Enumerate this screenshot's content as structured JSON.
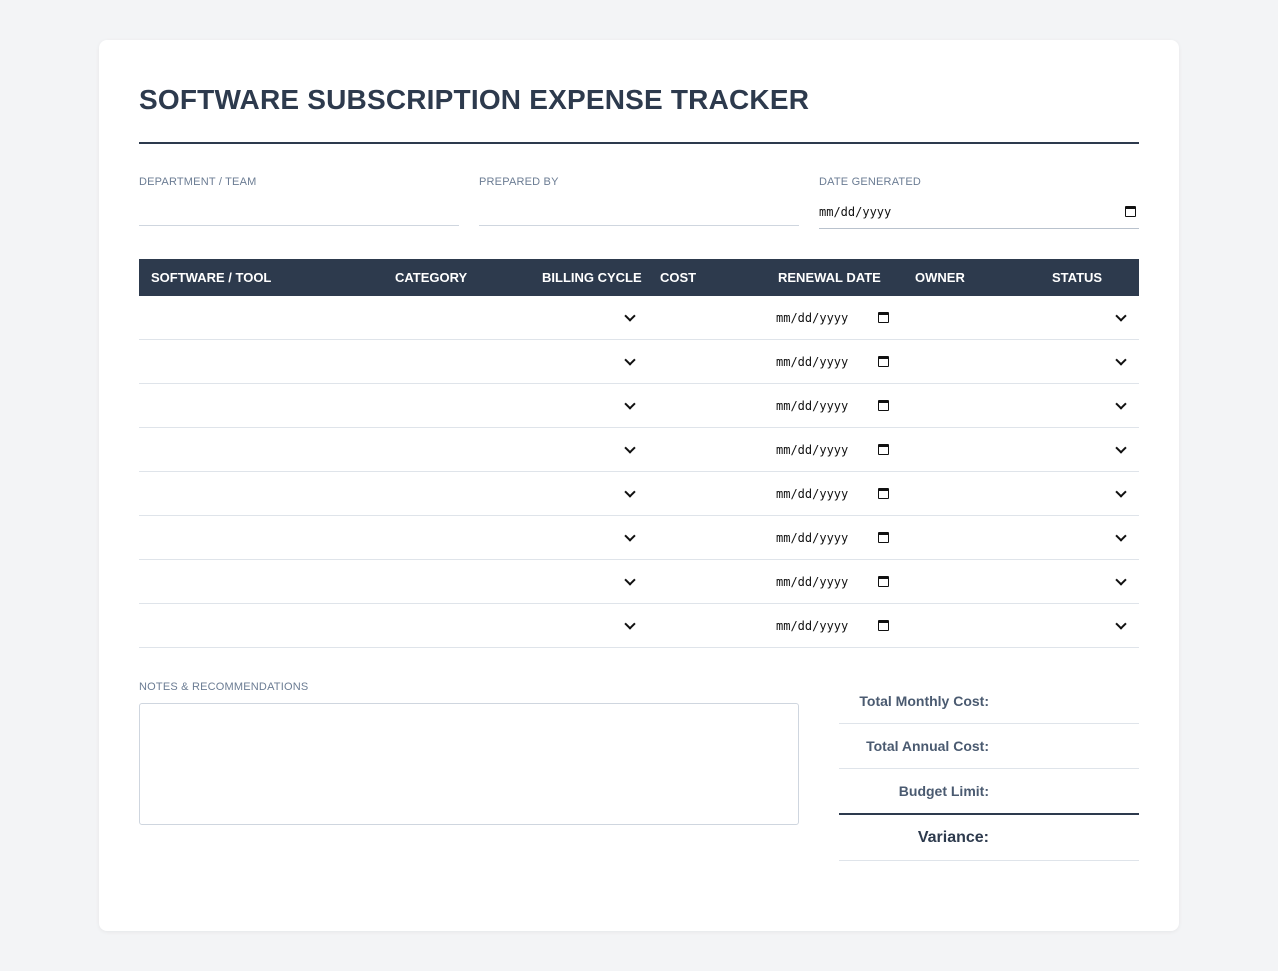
{
  "title": "SOFTWARE SUBSCRIPTION EXPENSE TRACKER",
  "meta_fields": {
    "department": {
      "label": "DEPARTMENT / TEAM",
      "value": ""
    },
    "prepared_by": {
      "label": "PREPARED BY",
      "value": ""
    },
    "date_generated": {
      "label": "DATE GENERATED",
      "value": "mm/dd/yyyy"
    }
  },
  "table": {
    "columns": [
      "SOFTWARE / TOOL",
      "CATEGORY",
      "BILLING CYCLE",
      "COST",
      "RENEWAL DATE",
      "OWNER",
      "STATUS"
    ],
    "date_placeholder": "mm/dd/yyyy",
    "rows": [
      {
        "software": "",
        "category": "",
        "billing_cycle": "",
        "cost": "",
        "renewal_date": "mm/dd/yyyy",
        "owner": "",
        "status": ""
      },
      {
        "software": "",
        "category": "",
        "billing_cycle": "",
        "cost": "",
        "renewal_date": "mm/dd/yyyy",
        "owner": "",
        "status": ""
      },
      {
        "software": "",
        "category": "",
        "billing_cycle": "",
        "cost": "",
        "renewal_date": "mm/dd/yyyy",
        "owner": "",
        "status": ""
      },
      {
        "software": "",
        "category": "",
        "billing_cycle": "",
        "cost": "",
        "renewal_date": "mm/dd/yyyy",
        "owner": "",
        "status": ""
      },
      {
        "software": "",
        "category": "",
        "billing_cycle": "",
        "cost": "",
        "renewal_date": "mm/dd/yyyy",
        "owner": "",
        "status": ""
      },
      {
        "software": "",
        "category": "",
        "billing_cycle": "",
        "cost": "",
        "renewal_date": "mm/dd/yyyy",
        "owner": "",
        "status": ""
      },
      {
        "software": "",
        "category": "",
        "billing_cycle": "",
        "cost": "",
        "renewal_date": "mm/dd/yyyy",
        "owner": "",
        "status": ""
      },
      {
        "software": "",
        "category": "",
        "billing_cycle": "",
        "cost": "",
        "renewal_date": "mm/dd/yyyy",
        "owner": "",
        "status": ""
      }
    ]
  },
  "notes": {
    "label": "NOTES & RECOMMENDATIONS",
    "value": ""
  },
  "totals": {
    "monthly_label": "Total Monthly Cost:",
    "annual_label": "Total Annual Cost:",
    "budget_label": "Budget Limit:",
    "variance_label": "Variance:"
  },
  "icons": {
    "date": "calendar-icon",
    "select": "chevron-down-icon"
  },
  "colors": {
    "header_bg": "#2d3a4d",
    "page_bg": "#f3f4f6",
    "card_bg": "#ffffff",
    "label_text": "#6b7c93"
  }
}
